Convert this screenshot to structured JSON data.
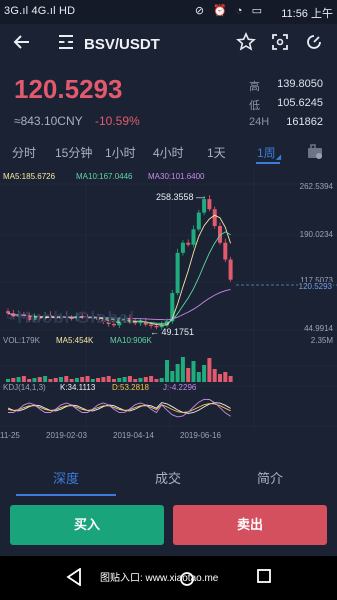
{
  "statusbar": {
    "network_left": "3G.ıl 4G.ıl HD",
    "icons": "⊘ ⏰ ◔ ▭",
    "time": "11:56 上午"
  },
  "header": {
    "pair": "BSV/USDT"
  },
  "ticker": {
    "last_price": "120.5293",
    "cny": "≈843.10CNY",
    "change_pct": "-10.59%",
    "stats": [
      {
        "label": "高",
        "value": "139.8050"
      },
      {
        "label": "低",
        "value": "105.6245"
      },
      {
        "label": "24H",
        "value": "161862"
      }
    ]
  },
  "timeframes": [
    "分时",
    "15分钟",
    "1小时",
    "4小时",
    "1天",
    "1周"
  ],
  "active_timeframe": "1周",
  "chart": {
    "ma_labels": [
      "MA5:185.6726",
      "MA10:167.0446",
      "MA30:101.6400"
    ],
    "price_axis": [
      "262.5394",
      "190.0234",
      "117.5073",
      "120.5293",
      "44.9914"
    ],
    "high_marker": "258.3558",
    "low_marker": "49.1751",
    "vol_labels": [
      "VOL:179K",
      "MA5:454K",
      "MA10:906K"
    ],
    "vol_axis": "2.35M",
    "kdj_labels": [
      "KDJ(14,1,3)",
      "K:34.1113",
      "D:53.2818",
      "J:-4.2296"
    ],
    "dates": [
      "11-25",
      "2019-02-03",
      "2019-04-14",
      "2019-06-16"
    ],
    "colors": {
      "up": "#1fad7e",
      "down": "#e25a6e",
      "ma5": "#f6e8a2",
      "ma10": "#5fd6a3",
      "ma30": "#c78ae6",
      "k": "#f1f1f1",
      "d": "#f3c64c",
      "j": "#c38df0"
    }
  },
  "chart_data": {
    "type": "candlestick",
    "last_price": 120.5293,
    "y_price_range": [
      44.9914,
      262.5394
    ],
    "candles_close_approx": [
      70,
      65,
      68,
      66,
      60,
      64,
      62,
      67,
      64,
      62,
      65,
      63,
      62,
      66,
      64,
      62,
      63,
      60,
      57,
      54,
      52,
      60,
      62,
      58,
      55,
      57,
      53,
      51,
      49,
      52,
      58,
      100,
      160,
      175,
      172,
      195,
      220,
      240,
      225,
      200,
      175,
      150,
      120
    ]
  },
  "bottom_tabs": [
    "深度",
    "成交",
    "简介"
  ],
  "active_bottom_tab": "深度",
  "actions": {
    "buy": "买入",
    "sell": "卖出"
  },
  "navbar": {
    "watermark": "图贴入口: www.xiaotao.me"
  }
}
